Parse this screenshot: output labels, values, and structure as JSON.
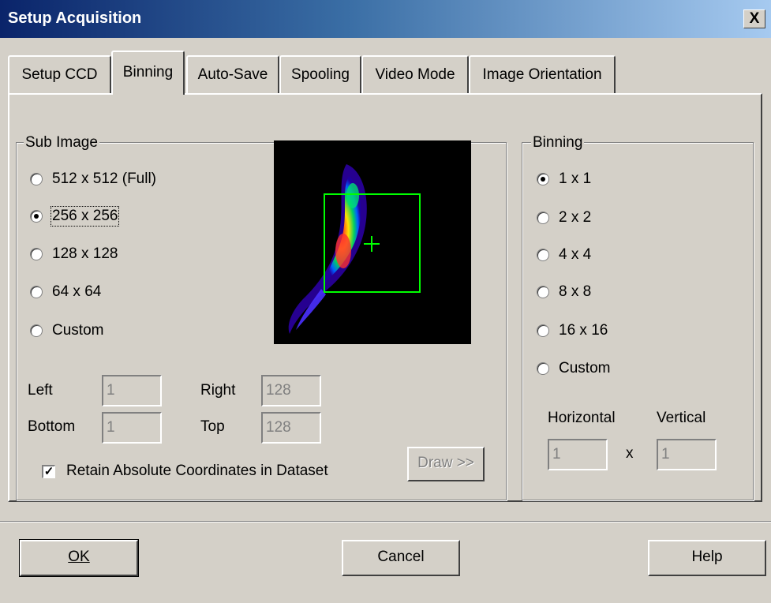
{
  "window": {
    "title": "Setup Acquisition",
    "close_label": "X"
  },
  "tabs": [
    "Setup CCD",
    "Binning",
    "Auto-Save",
    "Spooling",
    "Video Mode",
    "Image Orientation"
  ],
  "active_tab": "Binning",
  "sub_image": {
    "legend": "Sub Image",
    "options": [
      "512 x 512 (Full)",
      "256 x 256",
      "128 x 128",
      "64 x 64",
      "Custom"
    ],
    "selected": "256 x 256",
    "fields": {
      "left_label": "Left",
      "left_value": "1",
      "right_label": "Right",
      "right_value": "128",
      "bottom_label": "Bottom",
      "bottom_value": "1",
      "top_label": "Top",
      "top_value": "128"
    },
    "retain_label": "Retain Absolute Coordinates in Dataset",
    "retain_checked": true,
    "check_mark": "✓",
    "draw_label": "Draw >>"
  },
  "binning": {
    "legend": "Binning",
    "options": [
      "1 x 1",
      "2 x 2",
      "4 x 4",
      "8 x 8",
      "16 x 16",
      "Custom"
    ],
    "selected": "1 x 1",
    "horizontal_label": "Horizontal",
    "horizontal_value": "1",
    "vertical_label": "Vertical",
    "vertical_value": "1",
    "times_label": "x"
  },
  "buttons": {
    "ok_label": "OK",
    "cancel_label": "Cancel",
    "help_label": "Help"
  },
  "colors": {
    "title_start": "#0a246a",
    "title_end": "#a6caf0",
    "face": "#d4d0c8",
    "roi": "#00ff00"
  }
}
